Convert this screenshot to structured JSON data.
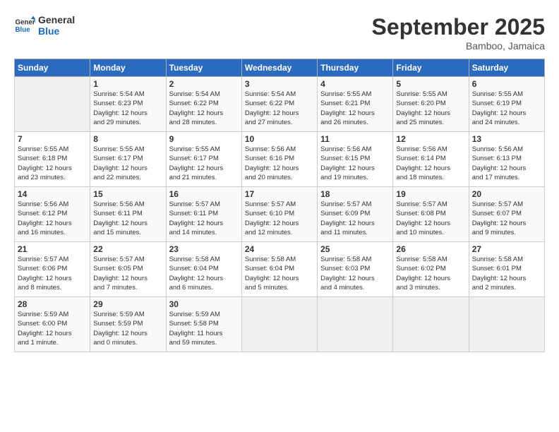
{
  "header": {
    "logo": {
      "line1": "General",
      "line2": "Blue"
    },
    "title": "September 2025",
    "location": "Bamboo, Jamaica"
  },
  "days_of_week": [
    "Sunday",
    "Monday",
    "Tuesday",
    "Wednesday",
    "Thursday",
    "Friday",
    "Saturday"
  ],
  "weeks": [
    [
      {
        "day": "",
        "info": ""
      },
      {
        "day": "1",
        "info": "Sunrise: 5:54 AM\nSunset: 6:23 PM\nDaylight: 12 hours\nand 29 minutes."
      },
      {
        "day": "2",
        "info": "Sunrise: 5:54 AM\nSunset: 6:22 PM\nDaylight: 12 hours\nand 28 minutes."
      },
      {
        "day": "3",
        "info": "Sunrise: 5:54 AM\nSunset: 6:22 PM\nDaylight: 12 hours\nand 27 minutes."
      },
      {
        "day": "4",
        "info": "Sunrise: 5:55 AM\nSunset: 6:21 PM\nDaylight: 12 hours\nand 26 minutes."
      },
      {
        "day": "5",
        "info": "Sunrise: 5:55 AM\nSunset: 6:20 PM\nDaylight: 12 hours\nand 25 minutes."
      },
      {
        "day": "6",
        "info": "Sunrise: 5:55 AM\nSunset: 6:19 PM\nDaylight: 12 hours\nand 24 minutes."
      }
    ],
    [
      {
        "day": "7",
        "info": "Sunrise: 5:55 AM\nSunset: 6:18 PM\nDaylight: 12 hours\nand 23 minutes."
      },
      {
        "day": "8",
        "info": "Sunrise: 5:55 AM\nSunset: 6:17 PM\nDaylight: 12 hours\nand 22 minutes."
      },
      {
        "day": "9",
        "info": "Sunrise: 5:55 AM\nSunset: 6:17 PM\nDaylight: 12 hours\nand 21 minutes."
      },
      {
        "day": "10",
        "info": "Sunrise: 5:56 AM\nSunset: 6:16 PM\nDaylight: 12 hours\nand 20 minutes."
      },
      {
        "day": "11",
        "info": "Sunrise: 5:56 AM\nSunset: 6:15 PM\nDaylight: 12 hours\nand 19 minutes."
      },
      {
        "day": "12",
        "info": "Sunrise: 5:56 AM\nSunset: 6:14 PM\nDaylight: 12 hours\nand 18 minutes."
      },
      {
        "day": "13",
        "info": "Sunrise: 5:56 AM\nSunset: 6:13 PM\nDaylight: 12 hours\nand 17 minutes."
      }
    ],
    [
      {
        "day": "14",
        "info": "Sunrise: 5:56 AM\nSunset: 6:12 PM\nDaylight: 12 hours\nand 16 minutes."
      },
      {
        "day": "15",
        "info": "Sunrise: 5:56 AM\nSunset: 6:11 PM\nDaylight: 12 hours\nand 15 minutes."
      },
      {
        "day": "16",
        "info": "Sunrise: 5:57 AM\nSunset: 6:11 PM\nDaylight: 12 hours\nand 14 minutes."
      },
      {
        "day": "17",
        "info": "Sunrise: 5:57 AM\nSunset: 6:10 PM\nDaylight: 12 hours\nand 12 minutes."
      },
      {
        "day": "18",
        "info": "Sunrise: 5:57 AM\nSunset: 6:09 PM\nDaylight: 12 hours\nand 11 minutes."
      },
      {
        "day": "19",
        "info": "Sunrise: 5:57 AM\nSunset: 6:08 PM\nDaylight: 12 hours\nand 10 minutes."
      },
      {
        "day": "20",
        "info": "Sunrise: 5:57 AM\nSunset: 6:07 PM\nDaylight: 12 hours\nand 9 minutes."
      }
    ],
    [
      {
        "day": "21",
        "info": "Sunrise: 5:57 AM\nSunset: 6:06 PM\nDaylight: 12 hours\nand 8 minutes."
      },
      {
        "day": "22",
        "info": "Sunrise: 5:57 AM\nSunset: 6:05 PM\nDaylight: 12 hours\nand 7 minutes."
      },
      {
        "day": "23",
        "info": "Sunrise: 5:58 AM\nSunset: 6:04 PM\nDaylight: 12 hours\nand 6 minutes."
      },
      {
        "day": "24",
        "info": "Sunrise: 5:58 AM\nSunset: 6:04 PM\nDaylight: 12 hours\nand 5 minutes."
      },
      {
        "day": "25",
        "info": "Sunrise: 5:58 AM\nSunset: 6:03 PM\nDaylight: 12 hours\nand 4 minutes."
      },
      {
        "day": "26",
        "info": "Sunrise: 5:58 AM\nSunset: 6:02 PM\nDaylight: 12 hours\nand 3 minutes."
      },
      {
        "day": "27",
        "info": "Sunrise: 5:58 AM\nSunset: 6:01 PM\nDaylight: 12 hours\nand 2 minutes."
      }
    ],
    [
      {
        "day": "28",
        "info": "Sunrise: 5:59 AM\nSunset: 6:00 PM\nDaylight: 12 hours\nand 1 minute."
      },
      {
        "day": "29",
        "info": "Sunrise: 5:59 AM\nSunset: 5:59 PM\nDaylight: 12 hours\nand 0 minutes."
      },
      {
        "day": "30",
        "info": "Sunrise: 5:59 AM\nSunset: 5:58 PM\nDaylight: 11 hours\nand 59 minutes."
      },
      {
        "day": "",
        "info": ""
      },
      {
        "day": "",
        "info": ""
      },
      {
        "day": "",
        "info": ""
      },
      {
        "day": "",
        "info": ""
      }
    ]
  ]
}
